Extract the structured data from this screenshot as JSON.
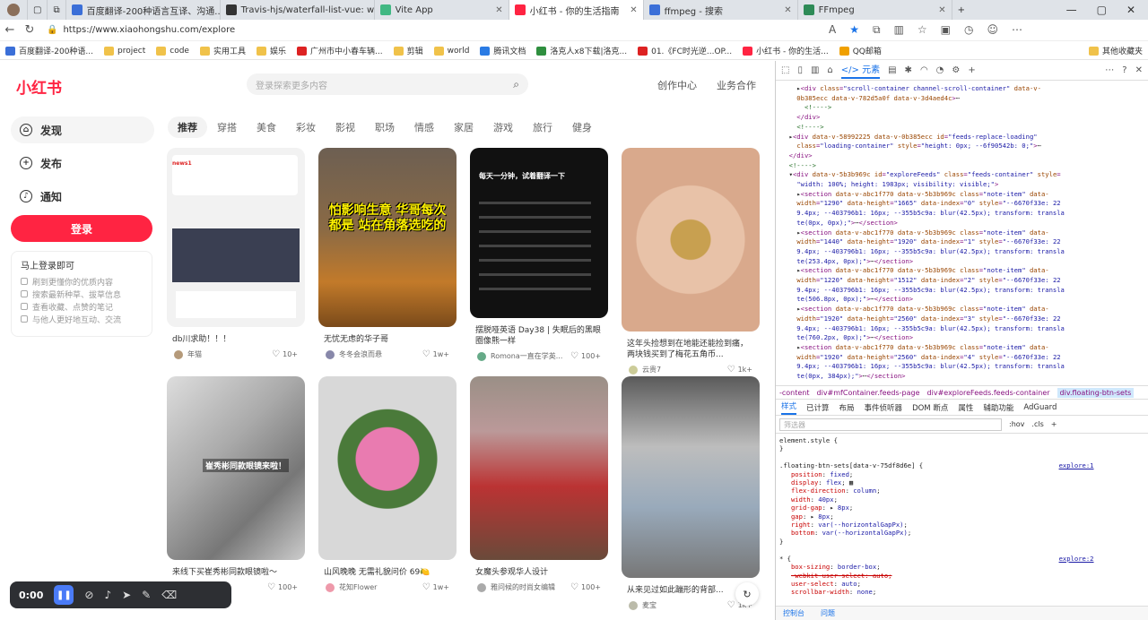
{
  "browser": {
    "tabs": [
      {
        "label": "百度翻译-200种语言互译、沟通...",
        "color": "#3b6fd8"
      },
      {
        "label": "Travis-hjs/waterfall-list-vue: wat...",
        "color": "#333333"
      },
      {
        "label": "Vite App",
        "color": "#41b883"
      },
      {
        "label": "小红书 - 你的生活指南",
        "color": "#ff2442",
        "active": true
      },
      {
        "label": "ffmpeg - 搜索",
        "color": "#3b6fd8"
      },
      {
        "label": "FFmpeg",
        "color": "#2e8b57"
      }
    ],
    "url": "https://www.xiaohongshu.com/explore",
    "bookmarks": [
      {
        "label": "百度翻译-200种语...",
        "color": "#3b6fd8"
      },
      {
        "label": "project",
        "color": "#f0c24a"
      },
      {
        "label": "code",
        "color": "#f0c24a"
      },
      {
        "label": "实用工具",
        "color": "#f0c24a"
      },
      {
        "label": "娱乐",
        "color": "#f0c24a"
      },
      {
        "label": "广州市中小春车辆...",
        "color": "#d22"
      },
      {
        "label": "剪辑",
        "color": "#f0c24a"
      },
      {
        "label": "world",
        "color": "#f0c24a"
      },
      {
        "label": "腾讯文档",
        "color": "#2a7be4"
      },
      {
        "label": "洛克人x8下载|洛克...",
        "color": "#2f8f3f"
      },
      {
        "label": "01.《FC时光逆...OP...",
        "color": "#d22"
      },
      {
        "label": "小红书 - 你的生活...",
        "color": "#ff2442"
      },
      {
        "label": "QQ邮箱",
        "color": "#f0a000"
      }
    ],
    "other_bookmarks": "其他收藏夹"
  },
  "site": {
    "logo": "小红书",
    "search_placeholder": "登录探索更多内容",
    "top_links": [
      "创作中心",
      "业务合作"
    ],
    "sidenav": [
      {
        "label": "发现",
        "icon": "⌂"
      },
      {
        "label": "发布",
        "icon": "+"
      },
      {
        "label": "通知",
        "icon": "♪"
      }
    ],
    "login_button": "登录",
    "login_box": {
      "title": "马上登录即可",
      "items": [
        "刷到更懂你的优质内容",
        "搜索最新种草、拔草信息",
        "查看收藏、点赞的笔记",
        "与他人更好地互动、交流"
      ]
    },
    "channels": [
      "推荐",
      "穿搭",
      "美食",
      "彩妆",
      "影视",
      "职场",
      "情感",
      "家居",
      "游戏",
      "旅行",
      "健身"
    ],
    "active_channel": "推荐",
    "cards": [
      {
        "title": "db川求助！！！",
        "author": "年猫",
        "likes": "10+",
        "overlay": ""
      },
      {
        "title": "无忧无虑的华子哥",
        "author": "冬冬会浪而悬",
        "likes": "1w+",
        "overlay": "怕影响生意 华哥每次都是 站在角落选吃的"
      },
      {
        "title": "摆脱哑英语 Day38 | 失眠后的黑眼圈像熊一样",
        "author": "Romona一直在学英...",
        "likes": "100+",
        "overlay": "每天一分钟，试着翻译一下"
      },
      {
        "title": "这年头捡想到在地能还能捡到痛，两块钱买到了梅花五角币...",
        "author": "云贵7",
        "likes": "1k+",
        "overlay": ""
      },
      {
        "title": "来线下买崔秀彬同款眼镜啦～",
        "author": "",
        "likes": "100+",
        "overlay": "崔秀彬同款眼镜来啦！"
      },
      {
        "title": "山风晚晚 无需礼貌问价 69🍋",
        "author": "花知Flower",
        "likes": "1w+",
        "overlay": ""
      },
      {
        "title": "女魔头参观华人设计",
        "author": "雅问候的时尚女编辑",
        "likes": "100+",
        "overlay": ""
      },
      {
        "title": "从来见过如此蹦形的背部...",
        "author": "麦宝",
        "likes": "1k+",
        "overlay": ""
      }
    ]
  },
  "devtools": {
    "toolbar_tab": "元素",
    "breadcrumbs": [
      "-content",
      "div#mfContainer.feeds-page",
      "div#exploreFeeds.feeds-container",
      "div.floating-btn-sets"
    ],
    "style_tabs": [
      "样式",
      "已计算",
      "布局",
      "事件侦听器",
      "DOM 断点",
      "属性",
      "辅助功能",
      "AdGuard"
    ],
    "active_style_tab": "样式",
    "filter_placeholder": "筛选器",
    "filter_options": [
      ":hov",
      ".cls",
      "+"
    ],
    "console_tabs": [
      "控制台",
      "问题"
    ]
  },
  "recorder": {
    "time": "0:00"
  }
}
